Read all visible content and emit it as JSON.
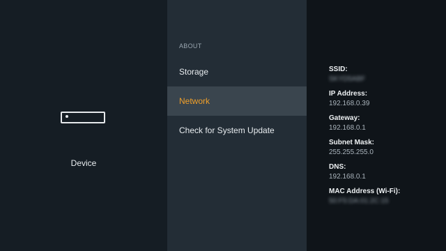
{
  "device_pane": {
    "label": "Device",
    "icon": "streaming-device-icon"
  },
  "about_menu": {
    "section_title": "ABOUT",
    "items": [
      {
        "label": "Storage",
        "selected": false
      },
      {
        "label": "Network",
        "selected": true
      },
      {
        "label": "Check for System Update",
        "selected": false
      }
    ]
  },
  "network_info": {
    "ssid_label": "SSID:",
    "ssid_value": "SKYD5ABF",
    "ip_label": "IP Address:",
    "ip_value": "192.168.0.39",
    "gateway_label": "Gateway:",
    "gateway_value": "192.168.0.1",
    "subnet_label": "Subnet Mask:",
    "subnet_value": "255.255.255.0",
    "dns_label": "DNS:",
    "dns_value": "192.168.0.1",
    "mac_label": "MAC Address (Wi-Fi):",
    "mac_value": "50:F5:DA:01:2C:15"
  },
  "colors": {
    "accent": "#f0a02a",
    "selected_bg": "#3a454e"
  }
}
